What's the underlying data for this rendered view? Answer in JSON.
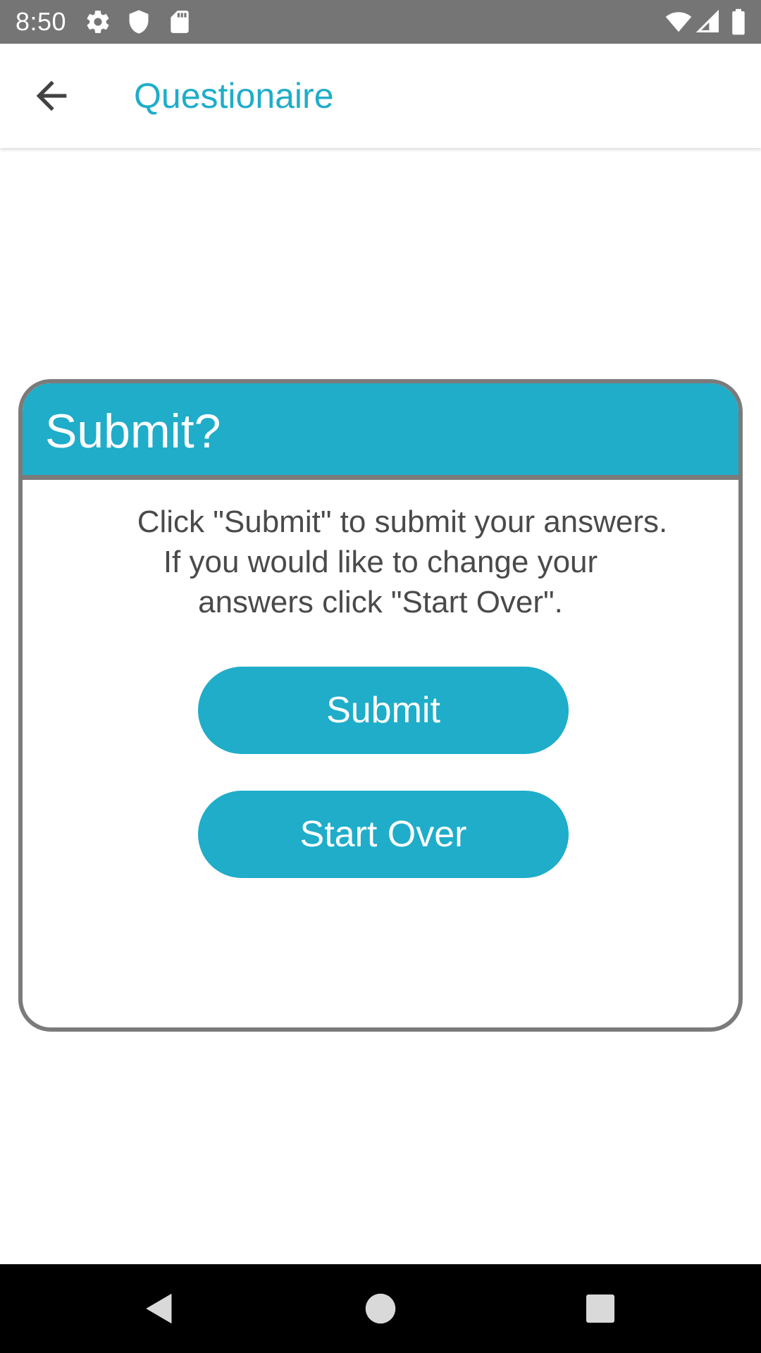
{
  "status_bar": {
    "time": "8:50",
    "icons": [
      "settings-icon",
      "shield-icon",
      "sd-card-icon",
      "wifi-icon",
      "signal-icon",
      "battery-icon"
    ]
  },
  "app_bar": {
    "back_icon": "arrow-back-icon",
    "title": "Questionaire"
  },
  "dialog": {
    "title": "Submit?",
    "message_lines": [
      "Click \"Submit\" to submit your answers.",
      "If you would like to change your",
      "answers click \"Start Over\"."
    ],
    "submit_label": "Submit",
    "start_over_label": "Start Over"
  },
  "nav_bar": {
    "icons": [
      "back-triangle-icon",
      "home-circle-icon",
      "recents-square-icon"
    ]
  },
  "colors": {
    "accent": "#1fadc9",
    "status_bar": "#757575",
    "dialog_border": "#7b7b7b",
    "text": "#4a4a4a"
  }
}
